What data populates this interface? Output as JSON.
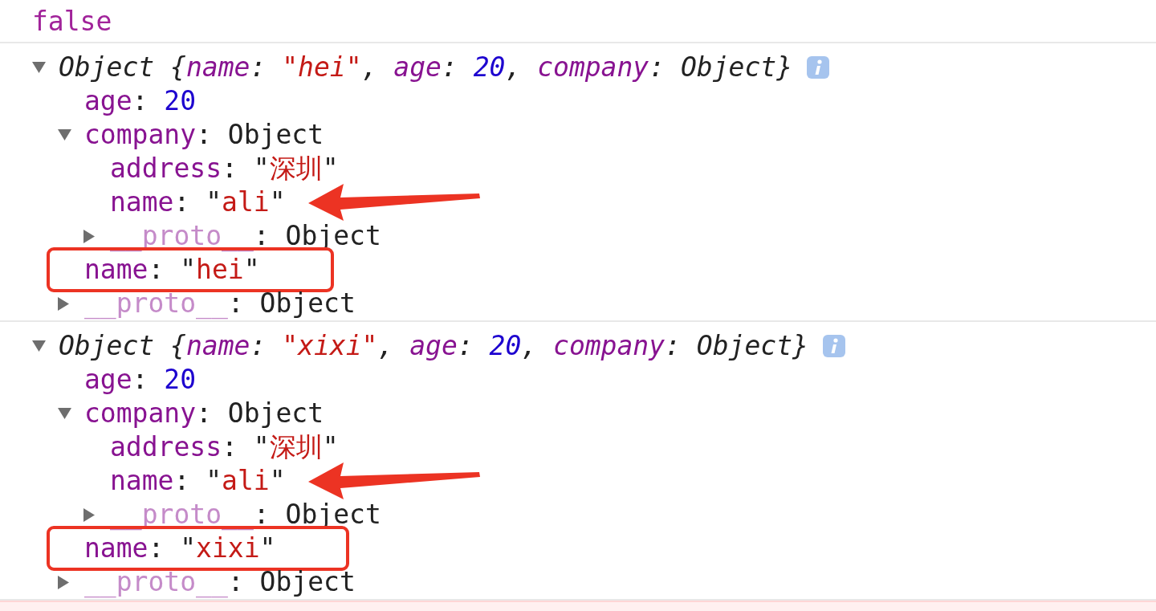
{
  "console": [
    {
      "kind": "value",
      "segments": [
        {
          "text": "false",
          "kind": "boolean"
        }
      ]
    },
    {
      "kind": "object",
      "expanded": true,
      "info_icon": true,
      "segments": [
        {
          "text": "Object {",
          "kind": "plain"
        },
        {
          "text": "name",
          "kind": "key"
        },
        {
          "text": ": ",
          "kind": "plain"
        },
        {
          "text": "\"hei\"",
          "kind": "string"
        },
        {
          "text": ", ",
          "kind": "plain"
        },
        {
          "text": "age",
          "kind": "key"
        },
        {
          "text": ": ",
          "kind": "plain"
        },
        {
          "text": "20",
          "kind": "number"
        },
        {
          "text": ", ",
          "kind": "plain"
        },
        {
          "text": "company",
          "kind": "key"
        },
        {
          "text": ": Object}",
          "kind": "plain"
        }
      ],
      "children": [
        {
          "boxed": false,
          "arrow": false,
          "segments": [
            {
              "text": "age",
              "kind": "key"
            },
            {
              "text": ": ",
              "kind": "plain"
            },
            {
              "text": "20",
              "kind": "number"
            }
          ]
        },
        {
          "boxed": false,
          "arrow": false,
          "expanded": true,
          "segments": [
            {
              "text": "company",
              "kind": "key"
            },
            {
              "text": ": ",
              "kind": "plain"
            },
            {
              "text": "Object",
              "kind": "plain"
            }
          ],
          "children": [
            {
              "boxed": false,
              "arrow": false,
              "segments": [
                {
                  "text": "address",
                  "kind": "key"
                },
                {
                  "text": ": ",
                  "kind": "plain"
                },
                {
                  "text": "\"",
                  "kind": "plain"
                },
                {
                  "text": "深圳",
                  "kind": "string"
                },
                {
                  "text": "\"",
                  "kind": "plain"
                }
              ]
            },
            {
              "boxed": false,
              "arrow": true,
              "segments": [
                {
                  "text": "name",
                  "kind": "key"
                },
                {
                  "text": ": ",
                  "kind": "plain"
                },
                {
                  "text": "\"",
                  "kind": "plain"
                },
                {
                  "text": "ali",
                  "kind": "string"
                },
                {
                  "text": "\"",
                  "kind": "plain"
                }
              ]
            },
            {
              "boxed": false,
              "arrow": false,
              "expanded": false,
              "segments": [
                {
                  "text": "__proto__",
                  "kind": "faded_key"
                },
                {
                  "text": ": ",
                  "kind": "plain"
                },
                {
                  "text": "Object",
                  "kind": "plain"
                }
              ]
            }
          ]
        },
        {
          "boxed": true,
          "arrow": false,
          "segments": [
            {
              "text": "name",
              "kind": "key"
            },
            {
              "text": ": ",
              "kind": "plain"
            },
            {
              "text": "\"",
              "kind": "plain"
            },
            {
              "text": "hei",
              "kind": "string"
            },
            {
              "text": "\"",
              "kind": "plain"
            }
          ]
        },
        {
          "boxed": false,
          "arrow": false,
          "expanded": false,
          "segments": [
            {
              "text": "__proto__",
              "kind": "faded_key"
            },
            {
              "text": ": ",
              "kind": "plain"
            },
            {
              "text": "Object",
              "kind": "plain"
            }
          ]
        }
      ]
    },
    {
      "kind": "object",
      "expanded": true,
      "info_icon": true,
      "segments": [
        {
          "text": "Object {",
          "kind": "plain"
        },
        {
          "text": "name",
          "kind": "key"
        },
        {
          "text": ": ",
          "kind": "plain"
        },
        {
          "text": "\"xixi\"",
          "kind": "string"
        },
        {
          "text": ", ",
          "kind": "plain"
        },
        {
          "text": "age",
          "kind": "key"
        },
        {
          "text": ": ",
          "kind": "plain"
        },
        {
          "text": "20",
          "kind": "number"
        },
        {
          "text": ", ",
          "kind": "plain"
        },
        {
          "text": "company",
          "kind": "key"
        },
        {
          "text": ": Object}",
          "kind": "plain"
        }
      ],
      "children": [
        {
          "boxed": false,
          "arrow": false,
          "segments": [
            {
              "text": "age",
              "kind": "key"
            },
            {
              "text": ": ",
              "kind": "plain"
            },
            {
              "text": "20",
              "kind": "number"
            }
          ]
        },
        {
          "boxed": false,
          "arrow": false,
          "expanded": true,
          "segments": [
            {
              "text": "company",
              "kind": "key"
            },
            {
              "text": ": ",
              "kind": "plain"
            },
            {
              "text": "Object",
              "kind": "plain"
            }
          ],
          "children": [
            {
              "boxed": false,
              "arrow": false,
              "segments": [
                {
                  "text": "address",
                  "kind": "key"
                },
                {
                  "text": ": ",
                  "kind": "plain"
                },
                {
                  "text": "\"",
                  "kind": "plain"
                },
                {
                  "text": "深圳",
                  "kind": "string"
                },
                {
                  "text": "\"",
                  "kind": "plain"
                }
              ]
            },
            {
              "boxed": false,
              "arrow": true,
              "segments": [
                {
                  "text": "name",
                  "kind": "key"
                },
                {
                  "text": ": ",
                  "kind": "plain"
                },
                {
                  "text": "\"",
                  "kind": "plain"
                },
                {
                  "text": "ali",
                  "kind": "string"
                },
                {
                  "text": "\"",
                  "kind": "plain"
                }
              ]
            },
            {
              "boxed": false,
              "arrow": false,
              "expanded": false,
              "segments": [
                {
                  "text": "__proto__",
                  "kind": "faded_key"
                },
                {
                  "text": ": ",
                  "kind": "plain"
                },
                {
                  "text": "Object",
                  "kind": "plain"
                }
              ]
            }
          ]
        },
        {
          "boxed": true,
          "arrow": false,
          "segments": [
            {
              "text": "name",
              "kind": "key"
            },
            {
              "text": ": ",
              "kind": "plain"
            },
            {
              "text": "\"",
              "kind": "plain"
            },
            {
              "text": "xixi",
              "kind": "string"
            },
            {
              "text": "\"",
              "kind": "plain"
            }
          ]
        },
        {
          "boxed": false,
          "arrow": false,
          "expanded": false,
          "segments": [
            {
              "text": "__proto__",
              "kind": "faded_key"
            },
            {
              "text": ": ",
              "kind": "plain"
            },
            {
              "text": "Object",
              "kind": "plain"
            }
          ]
        }
      ]
    },
    {
      "kind": "error"
    }
  ]
}
